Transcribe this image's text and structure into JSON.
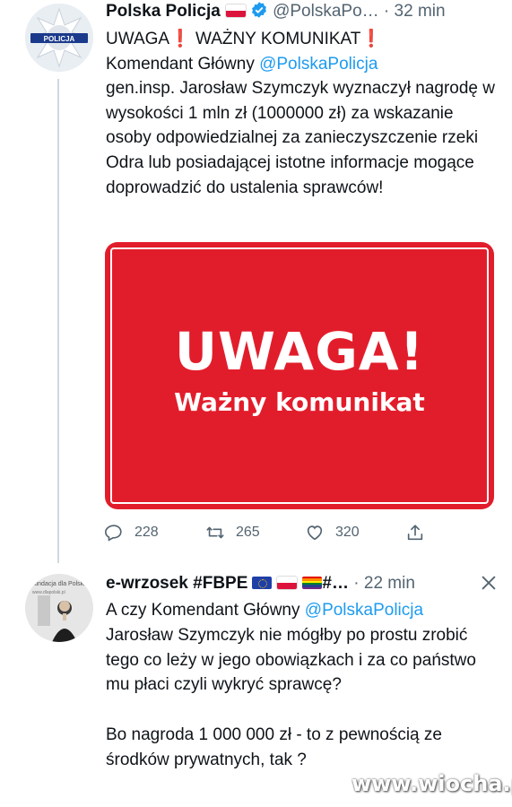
{
  "tweet1": {
    "author_name": "Polska Policja",
    "handle": "@PolskaPo…",
    "time": "· 32 min",
    "avatar_text": "POLICJA",
    "line1_text": "UWAGA",
    "line1_mid": " WAŻNY KOMUNIKAT",
    "line2_text": "Komendant Główny ",
    "mention": "@PolskaPolicja",
    "body_rest": "gen.insp. Jarosław Szymczyk wyznaczył nagrodę w wysokości 1 mln zł (1000000 zł) za wskazanie osoby odpowiedzialnej za zanieczyszczenie rzeki Odra lub posiadającej istotne informacje mogące doprowadzić do ustalenia sprawców!",
    "media": {
      "title": "UWAGA!",
      "subtitle": "Ważny komunikat",
      "color": "#e21d2b"
    },
    "actions": {
      "replies": "228",
      "retweets": "265",
      "likes": "320"
    }
  },
  "tweet2": {
    "author_name": "e-wrzosek #FBPE",
    "truncated_tail": "#…",
    "time": "· 22 min",
    "avatar_text": "Fundacja dla Polski",
    "avatar_text2": "www.dlapolski.pl",
    "line1_text": "A czy Komendant Główny  ",
    "mention": "@PolskaPolicja",
    "body_rest": "Jarosław Szymczyk nie mógłby po prostu zrobić tego co leży w jego obowiązkach i za co państwo  mu płaci czyli wykryć sprawcę?\n\nBo nagroda 1 000 000 zł - to z pewnością ze środków prywatnych, tak ?"
  },
  "watermark": "www.wiocha.pl",
  "colors": {
    "link": "#1d9bf0",
    "muted": "#536471",
    "verified": "#1d9bf0"
  }
}
